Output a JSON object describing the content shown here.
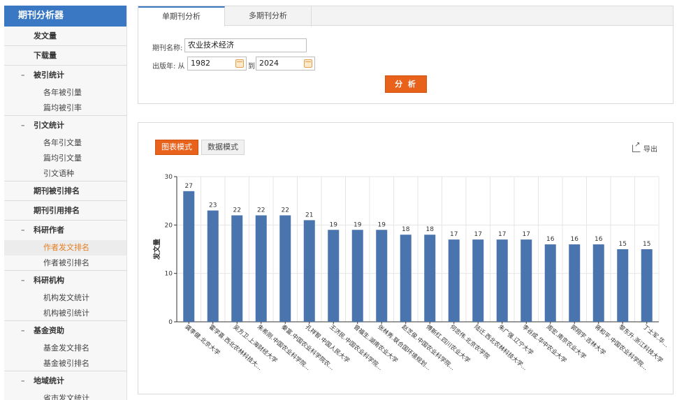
{
  "sidebar": {
    "title": "期刊分析器",
    "items": [
      {
        "kind": "top",
        "label": "发文量"
      },
      {
        "kind": "top",
        "label": "下载量"
      },
      {
        "kind": "group",
        "label": "被引统计"
      },
      {
        "kind": "sub",
        "label": "各年被引量"
      },
      {
        "kind": "sub",
        "label": "篇均被引率",
        "last": true
      },
      {
        "kind": "group",
        "label": "引文统计"
      },
      {
        "kind": "sub",
        "label": "各年引文量"
      },
      {
        "kind": "sub",
        "label": "篇均引文量"
      },
      {
        "kind": "sub",
        "label": "引文语种",
        "last": true
      },
      {
        "kind": "top",
        "label": "期刊被引排名"
      },
      {
        "kind": "top",
        "label": "期刊引用排名"
      },
      {
        "kind": "group",
        "label": "科研作者"
      },
      {
        "kind": "sub",
        "label": "作者发文排名",
        "active": true
      },
      {
        "kind": "sub",
        "label": "作者被引排名",
        "last": true
      },
      {
        "kind": "group",
        "label": "科研机构"
      },
      {
        "kind": "sub",
        "label": "机构发文统计"
      },
      {
        "kind": "sub",
        "label": "机构被引统计",
        "last": true
      },
      {
        "kind": "group",
        "label": "基金资助"
      },
      {
        "kind": "sub",
        "label": "基金发文排名"
      },
      {
        "kind": "sub",
        "label": "基金被引排名",
        "last": true
      },
      {
        "kind": "group",
        "label": "地域统计"
      },
      {
        "kind": "sub",
        "label": "省市发文统计"
      }
    ]
  },
  "tabs": {
    "single": "单期刊分析",
    "multi": "多期刊分析"
  },
  "form": {
    "journal_label": "期刊名称:",
    "journal_value": "农业技术经济",
    "year_label": "出版年: 从",
    "year_from": "1982",
    "to_label": "到",
    "year_to": "2024",
    "analyze_label": "分 析"
  },
  "view": {
    "chart_mode": "图表模式",
    "data_mode": "数据模式",
    "export_label": "导出"
  },
  "colors": {
    "bar": "#4a74ad",
    "accent": "#e8621c",
    "brand": "#3a78c3"
  },
  "chart_data": {
    "type": "bar",
    "ylabel": "发文量",
    "ylim": [
      0,
      30
    ],
    "yticks": [
      0,
      10,
      20,
      30
    ],
    "categories": [
      "龚李健.北京大学",
      "霍学喜.西北农林科技大...",
      "吴方卫.上海财经大学",
      "朱希刚.中国农业科学院...",
      "秦富.中国农业科学院农...",
      "孔祥智.中国人民大学",
      "王济民.中国农业科学院...",
      "曾福生.湖南农业大学",
      "张林秀.联合国环境规划...",
      "赵芝俊.中国农业科学院...",
      "傅新红.四川农业大学",
      "何忠伟.北京农学院",
      "陆迁.西北农林科技大学...",
      "朱广强.辽宁大学",
      "李谷成.华中农业大学",
      "周宏.南京农业大学",
      "郭翔宇.吉林大学",
      "蒋和平.中国农业科学院...",
      "黎东升.浙江科技大学",
      "丁士军.华..."
    ],
    "values": [
      27,
      23,
      22,
      22,
      22,
      21,
      19,
      19,
      19,
      18,
      18,
      17,
      17,
      17,
      17,
      16,
      16,
      16,
      15,
      15
    ]
  }
}
